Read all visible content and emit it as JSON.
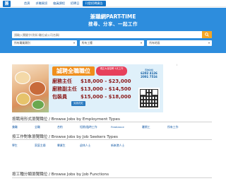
{
  "nav": {
    "logo_text": "兼",
    "links": [
      "首頁",
      "求職資訊",
      "僱員課程",
      "招聘日",
      "刊登招聘廣告"
    ],
    "active_index": 4,
    "accent_color": "#1676c9"
  },
  "hero": {
    "title": "兼職網PART-TIME",
    "subtitle": "搜尋、分享、一起工作",
    "background_color": "#2d8ddd",
    "search": {
      "placeholder": "請輸入關鍵字(例如:職位或公司名稱)",
      "button_icon": "search-icon",
      "button_color": "#f5a623"
    },
    "filters": [
      "所有職業類別",
      "所有工種",
      "所有地區"
    ]
  },
  "ad": {
    "tag": "誠聘全職職位",
    "badge": "現正大量招聘 5天工作",
    "rows": [
      {
        "role": "廚務主任",
        "pay": "$18,000 - $23,000"
      },
      {
        "role": "廚務副主任",
        "pay": "$13,000 - $14,500"
      },
      {
        "role": "包裝員",
        "pay": "$15,000 - $18,000"
      }
    ],
    "benefit": "另設花紅",
    "contact_label": "查詢熱線",
    "phone": "6202 4126",
    "phone2": "2001 7516",
    "corner_mark": "i"
  },
  "sections": {
    "employment": {
      "title": "按聘用形式瀏覽職位 / Browse Jobs by Employment Types",
      "items": [
        "兼職",
        "全職",
        "合約",
        "短期/臨時工作",
        "Freelance",
        "暑期工",
        "所有工作"
      ]
    },
    "seekers": {
      "title": "按工作對象瀏覽職位 / Browse Jobs by Job Seekers Types",
      "items": [
        "學生",
        "家庭主婦",
        "畢業生",
        "退休人士",
        "新來港人士"
      ]
    },
    "functions": {
      "title": "按工種分類瀏覽職位 / Browse Jobs by Job Functions"
    }
  }
}
